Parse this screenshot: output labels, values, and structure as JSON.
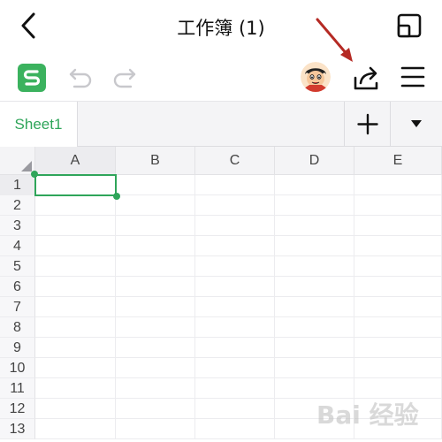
{
  "titlebar": {
    "title": "工作簿 (1)"
  },
  "toolbar": {
    "logo_letter": "S"
  },
  "sheets": {
    "active_tab": "Sheet1"
  },
  "grid": {
    "columns": [
      "A",
      "B",
      "C",
      "D",
      "E"
    ],
    "rows": [
      "1",
      "2",
      "3",
      "4",
      "5",
      "6",
      "7",
      "8",
      "9",
      "10",
      "11",
      "12",
      "13"
    ],
    "selected_cell": "A1"
  },
  "colors": {
    "accent": "#2fa55a",
    "logo_bg": "#3bb25e",
    "annotation": "#b52a24"
  },
  "watermark": {
    "text": "Bai 经验"
  }
}
